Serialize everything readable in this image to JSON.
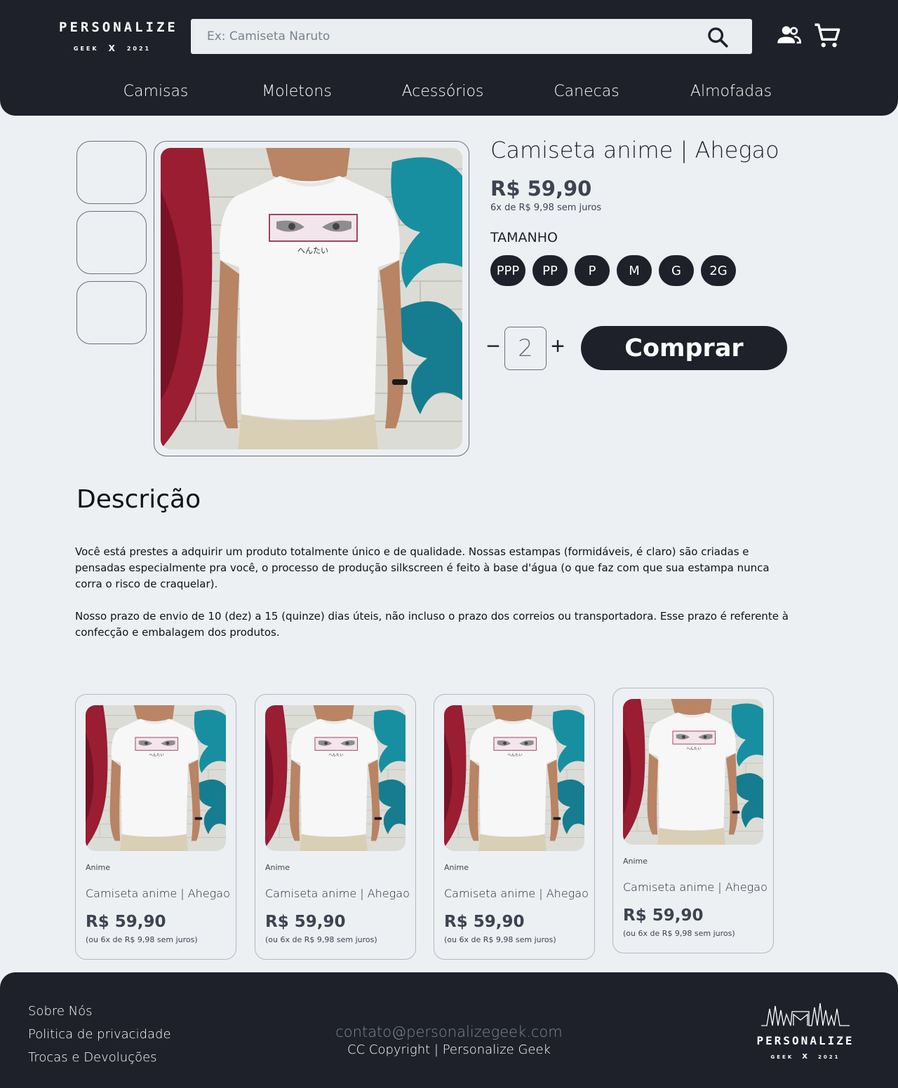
{
  "header": {
    "logo": {
      "main": "PERSONALIZE",
      "left": "GEEK",
      "x": "X",
      "right": "2021"
    },
    "search": {
      "placeholder": "Ex: Camiseta Naruto"
    },
    "nav": [
      "Camisas",
      "Moletons",
      "Acessórios",
      "Canecas",
      "Almofadas"
    ]
  },
  "product": {
    "title": "Camiseta anime | Ahegao",
    "price": "R$ 59,90",
    "installments": "6x de R$ 9,98 sem juros",
    "size_label": "TAMANHO",
    "sizes": [
      "PPP",
      "PP",
      "P",
      "M",
      "G",
      "2G"
    ],
    "quantity": "2",
    "buy_label": "Comprar",
    "print_text": "へんたい"
  },
  "description": {
    "title": "Descrição",
    "paragraphs": [
      "Você está prestes a adquirir um produto totalmente único e de qualidade. Nossas estampas (formidáveis, é claro) são criadas e pensadas especialmente pra você, o processo de produção silkscreen é feito à base d'água (o que faz com que sua estampa nunca corra o risco de craquelar).",
      "Nosso prazo de envio de 10 (dez) a 15 (quinze) dias úteis, não incluso o prazo dos correios ou transportadora. Esse prazo é referente à confecção e embalagem dos produtos."
    ]
  },
  "related": [
    {
      "category": "Anime",
      "name": "Camiseta anime | Ahegao",
      "price": "R$ 59,90",
      "installments": "(ou 6x de R$ 9,98 sem juros)"
    },
    {
      "category": "Anime",
      "name": "Camiseta anime | Ahegao",
      "price": "R$ 59,90",
      "installments": "(ou 6x de R$ 9,98 sem juros)"
    },
    {
      "category": "Anime",
      "name": "Camiseta anime | Ahegao",
      "price": "R$ 59,90",
      "installments": "(ou 6x de R$ 9,98 sem juros)"
    },
    {
      "category": "Anime",
      "name": "Camiseta anime | Ahegao",
      "price": "R$ 59,90",
      "installments": "(ou 6x de R$ 9,98 sem juros)"
    }
  ],
  "footer": {
    "links": [
      "Sobre Nós",
      "Politica de privacidade",
      "Trocas e Devoluções"
    ],
    "email": "contato@personalizegeek.com",
    "copyright": "CC Copyright | Personalize Geek",
    "logo": {
      "main": "PERSONALIZE",
      "left": "GEEK",
      "x": "X",
      "right": "2021"
    }
  },
  "icons": {
    "search": "search-icon",
    "user": "user-group-icon",
    "cart": "cart-icon"
  },
  "colors": {
    "dark": "#1E212A",
    "background": "#EDF0F3",
    "price": "#3D4350"
  }
}
